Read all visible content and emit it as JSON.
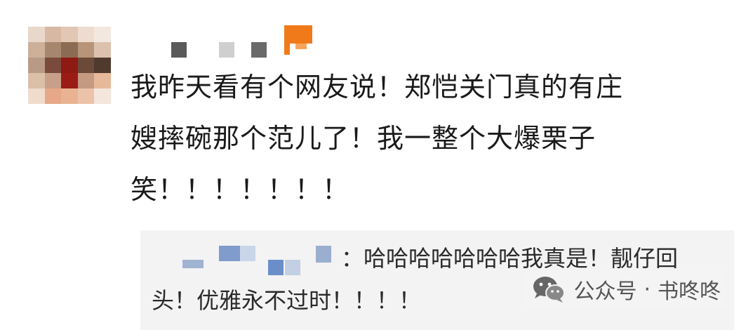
{
  "comment": {
    "lines": [
      "我昨天看有个网友说！郑恺关门真的有庄",
      "嫂摔碗那个范儿了！我一整个大爆栗子",
      "笑！！！！！！！"
    ]
  },
  "reply": {
    "name_suffix": "：",
    "line1": "哈哈哈哈哈哈哈我真是！靓仔回",
    "line2": "头！优雅永不过时！！！！"
  },
  "watermark": {
    "label": "公众号",
    "separator": "·",
    "account": "书咚咚"
  },
  "colors": {
    "badge": "#f07a1a",
    "reply_bg": "#f3f3f3",
    "text": "#1a1a1a",
    "reply_name_blur": "#6a8fc8"
  },
  "icons": {
    "badge": "orange-badge-icon",
    "watermark": "wechat-icon"
  }
}
